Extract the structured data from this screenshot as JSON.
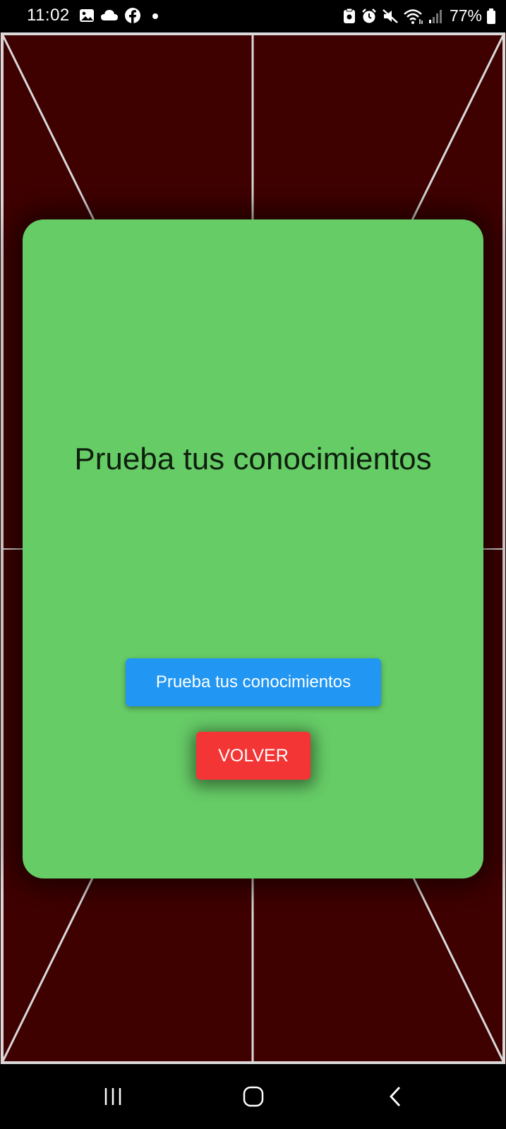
{
  "status_bar": {
    "time": "11:02",
    "battery": "77%",
    "left_icons": [
      "gallery-icon",
      "cloud-icon",
      "facebook-icon",
      "dot-icon"
    ],
    "right_icons": [
      "clipboard-icon",
      "alarm-icon",
      "mute-icon",
      "wifi-icon",
      "signal-icon",
      "battery-icon"
    ]
  },
  "card": {
    "title": "Prueba tus conocimientos",
    "quiz_button_label": "Prueba tus conocimientos",
    "back_button_label": "VOLVER"
  },
  "nav_bar": {
    "buttons": [
      "recent-apps-icon",
      "home-icon",
      "back-icon"
    ]
  },
  "colors": {
    "field_background": "#3f0000",
    "card_background": "#66cc66",
    "quiz_button": "#2196f3",
    "back_button": "#f43535",
    "field_lines": "#d9d9d9"
  }
}
